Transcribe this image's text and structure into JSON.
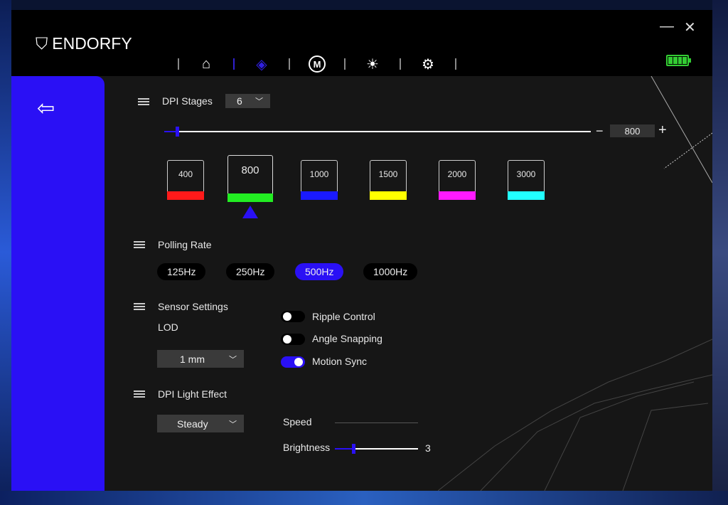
{
  "app": {
    "brand": "ENDORFY",
    "accent": "#2a10f5"
  },
  "nav": {
    "items": [
      {
        "icon": "home-icon"
      },
      {
        "icon": "dpi-icon",
        "active": true
      },
      {
        "icon": "macro-icon",
        "label": "M"
      },
      {
        "icon": "lighting-icon"
      },
      {
        "icon": "settings-icon"
      }
    ]
  },
  "battery": {
    "level": 1.0,
    "color": "#33cc33"
  },
  "dpi": {
    "label": "DPI Stages",
    "stages_count": "6",
    "current_value": "800",
    "minus": "−",
    "plus": "+",
    "slider_fraction": 0.03,
    "stages": [
      {
        "value": "400",
        "color": "#ff1a1a"
      },
      {
        "value": "800",
        "color": "#22ee22",
        "active": true
      },
      {
        "value": "1000",
        "color": "#1a1aff"
      },
      {
        "value": "1500",
        "color": "#ffff00"
      },
      {
        "value": "2000",
        "color": "#ff1aff"
      },
      {
        "value": "3000",
        "color": "#22ffff"
      }
    ]
  },
  "polling": {
    "label": "Polling Rate",
    "options": [
      "125Hz",
      "250Hz",
      "500Hz",
      "1000Hz"
    ],
    "selected": "500Hz"
  },
  "sensor": {
    "label": "Sensor Settings",
    "lod_label": "LOD",
    "lod_value": "1 mm",
    "toggles": [
      {
        "label": "Ripple Control",
        "on": false
      },
      {
        "label": "Angle Snapping",
        "on": false
      },
      {
        "label": "Motion Sync",
        "on": true
      }
    ]
  },
  "light": {
    "label": "DPI Light Effect",
    "effect": "Steady",
    "speed_label": "Speed",
    "brightness_label": "Brightness",
    "brightness_value": "3",
    "brightness_fraction": 0.22
  }
}
